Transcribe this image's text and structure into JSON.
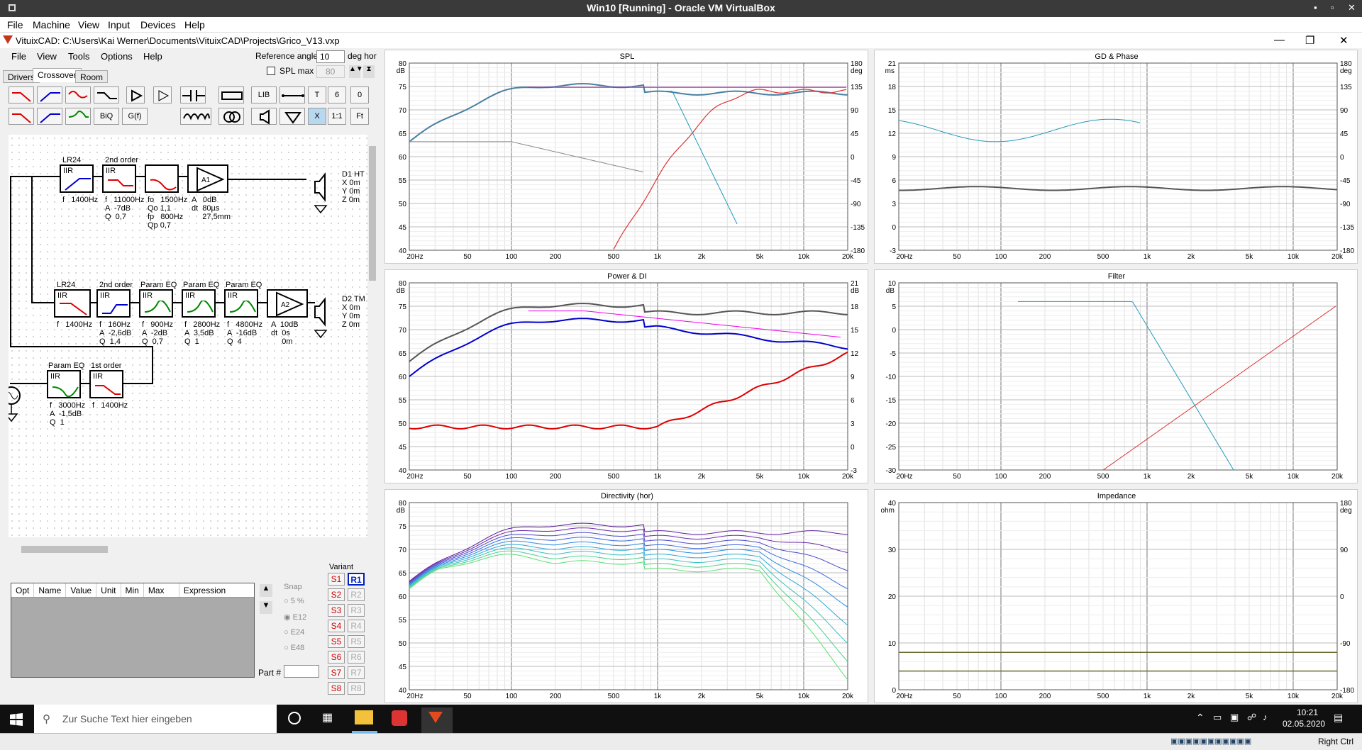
{
  "vbox": {
    "title": "Win10 [Running] - Oracle VM VirtualBox",
    "menu": [
      "File",
      "Machine",
      "View",
      "Input",
      "Devices",
      "Help"
    ]
  },
  "app": {
    "title": "VituixCAD: C:\\Users\\Kai Werner\\Documents\\VituixCAD\\Projects\\Grico_V13.vxp",
    "menu": [
      "File",
      "View",
      "Tools",
      "Options",
      "Help"
    ],
    "ref_angle_label": "Reference angle",
    "ref_angle_value": "10",
    "ref_angle_unit": "deg hor",
    "spl_max_label": "SPL max",
    "spl_max_value": "80",
    "tabs": [
      "Drivers",
      "Crossover",
      "Room"
    ],
    "toolbar": {
      "lib": "LIB",
      "t": "T",
      "six": "6",
      "zero": "0",
      "biq": "BiQ",
      "gf": "G(f)",
      "x": "X",
      "one": "1:1",
      "fit": "Ft"
    }
  },
  "schematic": {
    "row1": {
      "b1": "LR24",
      "b2": "2nd order",
      "b3": "",
      "b4": "",
      "c1": "f   1400Hz",
      "c2": "f   11000Hz\nA  -7dB\nQ  0,7",
      "c3": "fo   1500Hz\nQo 1,1\nfp   800Hz\nQp 0,7",
      "c4": "A   0dB\ndt  80µs\n     27,5mm",
      "amp": "A1",
      "driver": "D1 HT\nX 0m\nY 0m\nZ 0m"
    },
    "row2": {
      "b1": "LR24",
      "b2": "2nd order",
      "b3": "Param EQ",
      "b4": "Param EQ",
      "b5": "Param EQ",
      "c1": "f   1400Hz",
      "c2": "f   160Hz\nA  -2,6dB\nQ  1,4",
      "c3": "f   900Hz\nA  -2dB\nQ  0,7",
      "c4": "f   2800Hz\nA  3,5dB\nQ  1",
      "c5": "f   4800Hz\nA  -16dB\nQ  4",
      "c6": "A  10dB\ndt  0s\n     0m",
      "amp": "A2",
      "driver": "D2 TM\nX 0m\nY 0m\nZ 0m"
    },
    "row3": {
      "b1": "Param EQ",
      "b2": "1st order",
      "c1": "f   3000Hz\nA  -1,5dB\nQ  1",
      "c2": "f   1400Hz"
    },
    "iir": "IIR"
  },
  "opt_headers": [
    "Opt",
    "Name",
    "Value",
    "Unit",
    "Min",
    "Max",
    "Expression"
  ],
  "snap": {
    "label": "Snap",
    "opts": [
      "5 %",
      "E12",
      "E24",
      "E48"
    ]
  },
  "part_label": "Part #",
  "variant": {
    "label": "Variant",
    "s": [
      "S1",
      "S2",
      "S3",
      "S4",
      "S5",
      "S6",
      "S7",
      "S8"
    ],
    "r": [
      "R1",
      "R2",
      "R3",
      "R4",
      "R5",
      "R6",
      "R7",
      "R8"
    ]
  },
  "xticks": [
    "20Hz",
    "50",
    "100",
    "200",
    "500",
    "1k",
    "2k",
    "5k",
    "10k",
    "20k"
  ],
  "panels": [
    {
      "title": "SPL",
      "left": [
        "80",
        "75",
        "70",
        "65",
        "60",
        "55",
        "50",
        "45",
        "40"
      ],
      "lunit": "dB",
      "right": [
        "180",
        "135",
        "90",
        "45",
        "0",
        "-45",
        "-90",
        "-135",
        "-180"
      ],
      "runit": "deg"
    },
    {
      "title": "GD & Phase",
      "left": [
        "21",
        "18",
        "15",
        "12",
        "9",
        "6",
        "3",
        "0",
        "-3"
      ],
      "lunit": "ms",
      "right": [
        "180",
        "135",
        "90",
        "45",
        "0",
        "-45",
        "-90",
        "-135",
        "-180"
      ],
      "runit": "deg"
    },
    {
      "title": "Power & DI",
      "left": [
        "80",
        "75",
        "70",
        "65",
        "60",
        "55",
        "50",
        "45",
        "40"
      ],
      "lunit": "dB",
      "right": [
        "21",
        "18",
        "15",
        "12",
        "9",
        "6",
        "3",
        "0",
        "-3"
      ],
      "runit": "dB"
    },
    {
      "title": "Filter",
      "left": [
        "10",
        "5",
        "0",
        "-5",
        "-10",
        "-15",
        "-20",
        "-25",
        "-30"
      ],
      "lunit": "dB",
      "right": [],
      "runit": ""
    },
    {
      "title": "Directivity (hor)",
      "left": [
        "80",
        "75",
        "70",
        "65",
        "60",
        "55",
        "50",
        "45",
        "40"
      ],
      "lunit": "dB",
      "right": [],
      "runit": ""
    },
    {
      "title": "Impedance",
      "left": [
        "40",
        "30",
        "20",
        "10",
        "0"
      ],
      "lunit": "ohm",
      "right": [
        "180",
        "90",
        "0",
        "-90",
        "-180"
      ],
      "runit": "deg"
    }
  ],
  "taskbar": {
    "search": "Zur Suche Text hier eingeben",
    "time": "10:21",
    "date": "02.05.2020"
  },
  "status": {
    "right": "Right Ctrl"
  }
}
